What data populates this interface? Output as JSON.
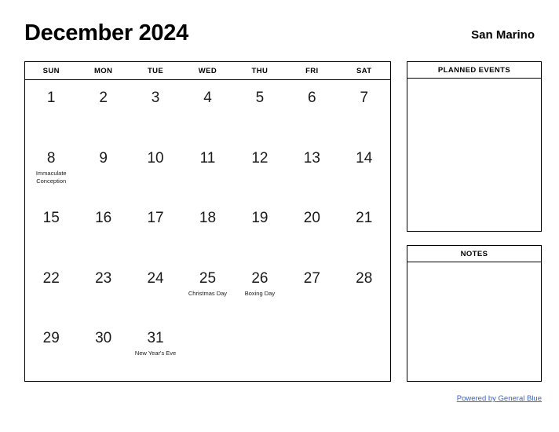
{
  "header": {
    "month_title": "December 2024",
    "location": "San Marino"
  },
  "calendar": {
    "weekdays": [
      "SUN",
      "MON",
      "TUE",
      "WED",
      "THU",
      "FRI",
      "SAT"
    ],
    "weeks": [
      [
        {
          "day": "1",
          "event": ""
        },
        {
          "day": "2",
          "event": ""
        },
        {
          "day": "3",
          "event": ""
        },
        {
          "day": "4",
          "event": ""
        },
        {
          "day": "5",
          "event": ""
        },
        {
          "day": "6",
          "event": ""
        },
        {
          "day": "7",
          "event": ""
        }
      ],
      [
        {
          "day": "8",
          "event": "Immaculate Conception"
        },
        {
          "day": "9",
          "event": ""
        },
        {
          "day": "10",
          "event": ""
        },
        {
          "day": "11",
          "event": ""
        },
        {
          "day": "12",
          "event": ""
        },
        {
          "day": "13",
          "event": ""
        },
        {
          "day": "14",
          "event": ""
        }
      ],
      [
        {
          "day": "15",
          "event": ""
        },
        {
          "day": "16",
          "event": ""
        },
        {
          "day": "17",
          "event": ""
        },
        {
          "day": "18",
          "event": ""
        },
        {
          "day": "19",
          "event": ""
        },
        {
          "day": "20",
          "event": ""
        },
        {
          "day": "21",
          "event": ""
        }
      ],
      [
        {
          "day": "22",
          "event": ""
        },
        {
          "day": "23",
          "event": ""
        },
        {
          "day": "24",
          "event": ""
        },
        {
          "day": "25",
          "event": "Christmas Day"
        },
        {
          "day": "26",
          "event": "Boxing Day"
        },
        {
          "day": "27",
          "event": ""
        },
        {
          "day": "28",
          "event": ""
        }
      ],
      [
        {
          "day": "29",
          "event": ""
        },
        {
          "day": "30",
          "event": ""
        },
        {
          "day": "31",
          "event": "New Year's Eve"
        },
        {
          "day": "",
          "event": ""
        },
        {
          "day": "",
          "event": ""
        },
        {
          "day": "",
          "event": ""
        },
        {
          "day": "",
          "event": ""
        }
      ]
    ]
  },
  "panels": {
    "planned_events_title": "PLANNED EVENTS",
    "planned_events_content": "",
    "notes_title": "NOTES",
    "notes_content": ""
  },
  "footer": {
    "link_text": "Powered by General Blue",
    "link_color": "#3a63c8"
  }
}
